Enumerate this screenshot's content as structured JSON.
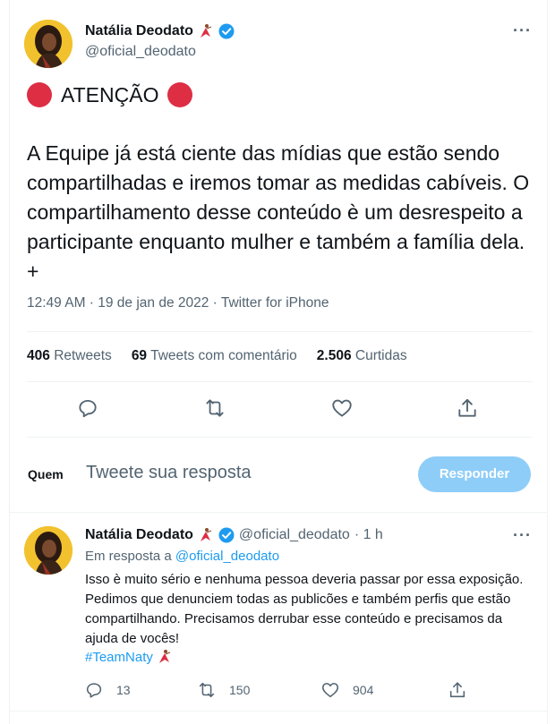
{
  "main_tweet": {
    "author_name": "Natália Deodato",
    "author_handle": "@oficial_deodato",
    "headline": "ATENÇÃO",
    "text": "A Equipe já está ciente das mídias que estão sendo compartilhadas e iremos tomar as medidas cabíveis. O compartilhamento desse conteúdo è um desrespeito a participante enquanto mulher e também a família dela. +",
    "meta": "12:49 AM · 19 de jan de 2022 · Twitter for iPhone",
    "stats": {
      "retweets_count": "406",
      "retweets_label": "Retweets",
      "quotes_count": "69",
      "quotes_label": "Tweets com comentário",
      "likes_count": "2.506",
      "likes_label": "Curtidas"
    }
  },
  "reply_box": {
    "avatar_text": "Quem",
    "placeholder": "Tweete sua resposta",
    "button_label": "Responder"
  },
  "reply_tweet": {
    "author_name": "Natália Deodato",
    "author_handle": "@oficial_deodato",
    "time": "· 1 h",
    "in_reply_prefix": "Em resposta a",
    "in_reply_handle": "@oficial_deodato",
    "text": "Isso è muito sério e nenhuma pessoa deveria passar por essa exposição. Pedimos que denunciem todas as publicões e também perfis que estão compartilhando. Precisamos derrubar esse conteúdo e precisamos da ajuda de vocês!",
    "hashtag": "#TeamNaty",
    "replies": "13",
    "retweets": "150",
    "likes": "904"
  },
  "more_glyph": "···",
  "colors": {
    "accent": "#1d9bf0",
    "button_disabled": "#8ecdf8",
    "alert_red": "#dd2e44",
    "secondary_text": "#536471"
  }
}
